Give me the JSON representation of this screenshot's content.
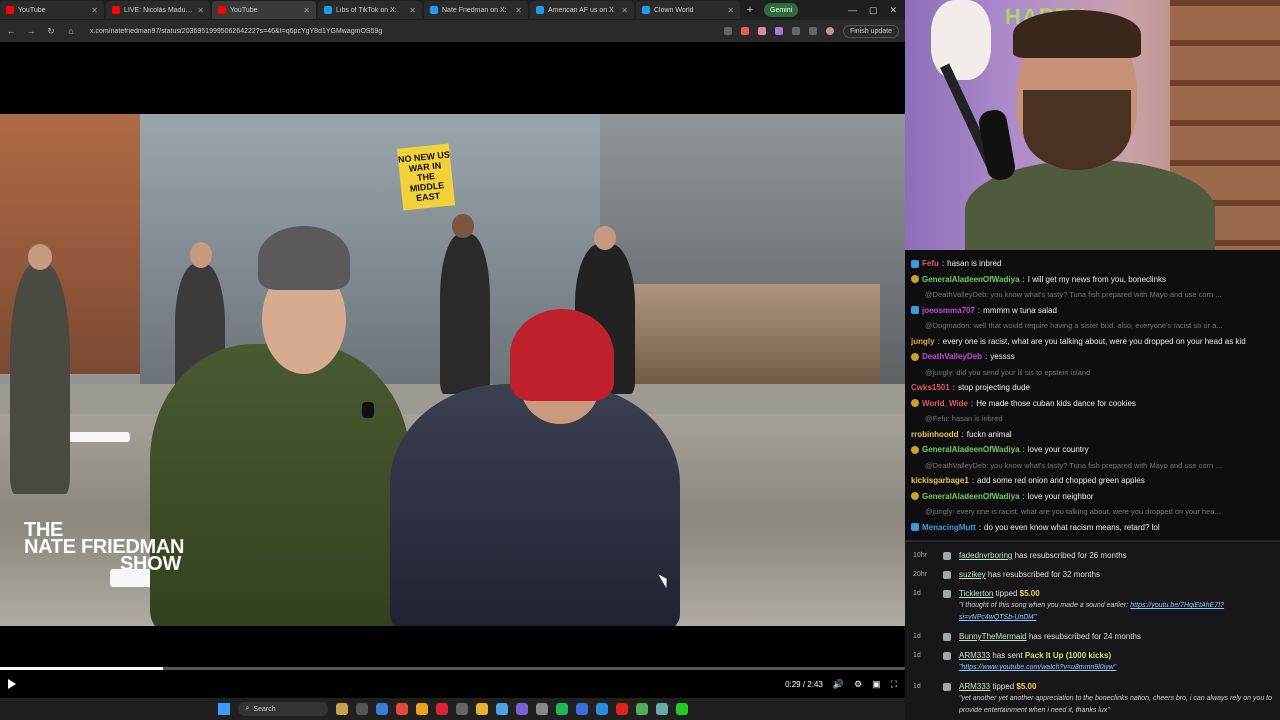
{
  "browser": {
    "tabs": [
      {
        "label": "YouTube",
        "color": "#ff0000"
      },
      {
        "label": "LIVE: Nicolás Maduro ap",
        "color": "#ff0000"
      },
      {
        "label": "YouTube",
        "color": "#ff0000"
      },
      {
        "label": "Libs of TikTok on X:",
        "color": "#1d9bf0"
      },
      {
        "label": "Nate Friedman on X:",
        "color": "#1d9bf0"
      },
      {
        "label": "American AF us on X",
        "color": "#1d9bf0"
      },
      {
        "label": "Clown World",
        "color": "#1d9bf0"
      }
    ],
    "gemini_label": "Gemini",
    "url": "x.com/natefriedman97/status/2036951999506264222?s=46&t=q6pcYgY8d1YGMwagmOS59g",
    "finish_update": "Finish update"
  },
  "video": {
    "sign_text": "NO NEW US WAR IN THE MIDDLE EAST",
    "watermark_line1": "THE",
    "watermark_line2": "NATE FRIEDMAN",
    "watermark_line3": "SHOW",
    "time": "0:29 / 2:43",
    "progress_fraction": 0.18
  },
  "taskbar": {
    "search_placeholder": "Search"
  },
  "webcam": {
    "banner": "HAPPY"
  },
  "chat": {
    "messages": [
      {
        "type": "msg",
        "badge": "blue",
        "user": "Fefu",
        "color": "#e05a5a",
        "text": "hasan is inbred"
      },
      {
        "type": "msg",
        "badge": "gold",
        "user": "GeneralAladeenOfWadiya",
        "color": "#6fcf5b",
        "text": "I will get my news from you, boneclinks"
      },
      {
        "type": "reply",
        "text": "@DeathValleyDeb: you know what's tasty? Tuna fish prepared with Mayo and use corn ..."
      },
      {
        "type": "msg",
        "badge": "blue",
        "user": "joeosmma707",
        "color": "#c04bd8",
        "text": "mmmm w tuna salad"
      },
      {
        "type": "reply",
        "text": "@Dogmadon: well that would require having a sister bud. also, everyone's racist so ur a..."
      },
      {
        "type": "msg",
        "badge": "none",
        "user": "jungly",
        "color": "#e8a33c",
        "text": "every one is racist, what are you talking about, were you dropped on your head as kid"
      },
      {
        "type": "msg",
        "badge": "gold",
        "user": "DeathValleyDeb",
        "color": "#c04bd8",
        "text": "yessss"
      },
      {
        "type": "reply",
        "text": "@jungly: did you send your lil sis to epstein island"
      },
      {
        "type": "msg",
        "badge": "none",
        "user": "Cwks1501",
        "color": "#e05a5a",
        "text": "stop projecting dude"
      },
      {
        "type": "msg",
        "badge": "gold",
        "user": "World_Wide",
        "color": "#e05a5a",
        "text": "He made those cuban kids dance for cookies"
      },
      {
        "type": "reply",
        "text": "@Fefu: hasan is inbred"
      },
      {
        "type": "msg",
        "badge": "none",
        "user": "rrobinhoodd",
        "color": "#e8c84a",
        "text": "fuckn animal"
      },
      {
        "type": "msg",
        "badge": "gold",
        "user": "GeneralAladeenOfWadiya",
        "color": "#6fcf5b",
        "text": "love your country"
      },
      {
        "type": "reply",
        "text": "@DeathValleyDeb: you know what's tasty? Tuna fish prepared with Mayo and use corn ..."
      },
      {
        "type": "msg",
        "badge": "none",
        "user": "kickisgarbage1",
        "color": "#e8c84a",
        "text": "add some red onion and chopped green apples"
      },
      {
        "type": "msg",
        "badge": "gold",
        "user": "GeneralAladeenOfWadiya",
        "color": "#6fcf5b",
        "text": "love your neighbor"
      },
      {
        "type": "reply",
        "text": "@jungly: every one is racist, what are you talking about, were you dropped on your hea..."
      },
      {
        "type": "msg",
        "badge": "blue",
        "user": "MenacingMutt",
        "color": "#3a9bd9",
        "text": "do you even know what racism means, retard? lol"
      }
    ]
  },
  "events": [
    {
      "time": "10hr",
      "user": "fadednvrboring",
      "text": "has resubscribed for 26 months"
    },
    {
      "time": "20hr",
      "user": "suzikey",
      "text": "has resubscribed for 32 months"
    },
    {
      "time": "1d",
      "user": "Ticklerton",
      "text": "tipped",
      "amount": "$5.00",
      "message": "\"I thought of this song when you made a sound earlier:",
      "link": "https://youtu.be/7HqiEtAhE7I?si=vNPc4wQTSb-UnDl4\""
    },
    {
      "time": "1d",
      "user": "BunnyTheMermaid",
      "text": "has resubscribed for 24 months"
    },
    {
      "time": "1d",
      "user": "ARM333",
      "text": "has sent",
      "gift": "Pack It Up (1000 kicks)",
      "link": "\"https://www.youtube.com/watch?v=u8mmn9l0iyw\""
    },
    {
      "time": "1d",
      "user": "ARM333",
      "text": "tipped",
      "amount": "$5.00",
      "message": "\"yet another yet another appreciation to the boneclinks nation, cheers bro, i can always rely on you to provide entertainment when i need it, thanks lux\""
    }
  ]
}
